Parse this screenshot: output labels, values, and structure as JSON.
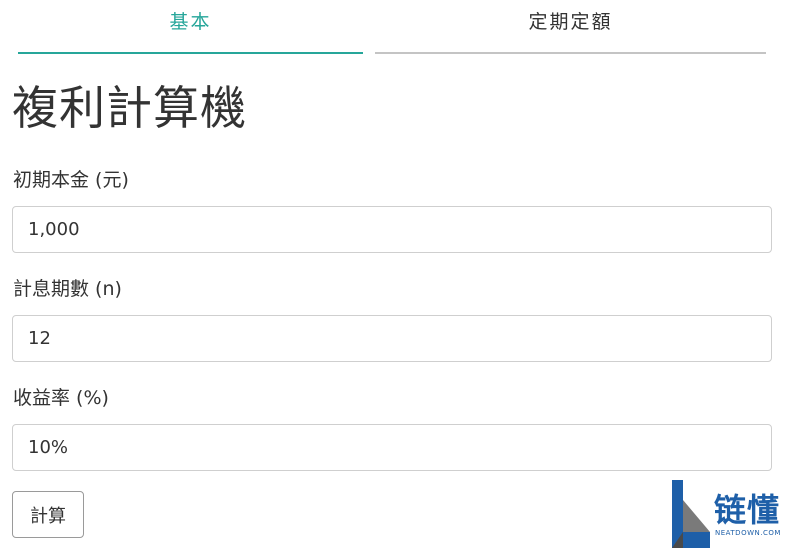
{
  "tabs": [
    {
      "label": "基本",
      "active": true
    },
    {
      "label": "定期定額",
      "active": false
    }
  ],
  "colors": {
    "accent": "#26a69a",
    "tab_underline_inactive": "#c4c4c4",
    "text": "#333333",
    "input_border": "#cfcfcf",
    "watermark_blue": "#1e5fa8"
  },
  "page_title": "複利計算機",
  "form": {
    "principal": {
      "label": "初期本金 (元)",
      "value": "1,000"
    },
    "periods": {
      "label": "計息期數 (n)",
      "value": "12"
    },
    "rate": {
      "label": "收益率 (%)",
      "value": "10%"
    },
    "submit_label": "計算"
  },
  "watermark": {
    "text": "链懂",
    "subtext": "NEATDOWN.COM"
  }
}
